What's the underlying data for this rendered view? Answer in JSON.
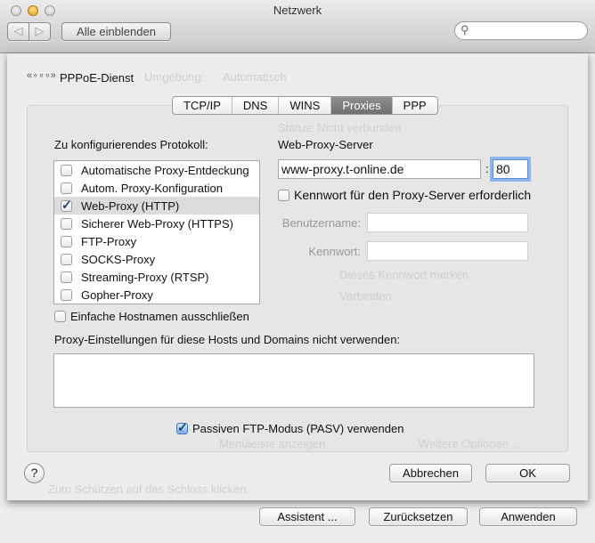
{
  "window": {
    "title": "Netzwerk",
    "show_all": "Alle einblenden",
    "search_placeholder": ""
  },
  "background": {
    "location_label": "Umgebung:",
    "location_value": "Automatisch",
    "status": "Status:  Nicht verbunden",
    "remember_password": "Dieses Kennwort merken",
    "connect": "Verbinden",
    "menubar": "Menüleiste anzeigen",
    "more_options": "Weitere Optionen ...",
    "lock_hint": "Zum Schützen auf das Schloss klicken."
  },
  "sheet": {
    "service_name": "PPPoE-Dienst",
    "tabs": [
      {
        "label": "TCP/IP"
      },
      {
        "label": "DNS"
      },
      {
        "label": "WINS"
      },
      {
        "label": "Proxies",
        "selected": true
      },
      {
        "label": "PPP"
      }
    ],
    "protocol_label": "Zu konfigurierendes Protokoll:",
    "protocols": [
      {
        "label": "Automatische Proxy-Entdeckung",
        "checked": false
      },
      {
        "label": "Autom. Proxy-Konfiguration",
        "checked": false
      },
      {
        "label": "Web-Proxy (HTTP)",
        "checked": true,
        "selected": true
      },
      {
        "label": "Sicherer Web-Proxy (HTTPS)",
        "checked": false
      },
      {
        "label": "FTP-Proxy",
        "checked": false
      },
      {
        "label": "SOCKS-Proxy",
        "checked": false
      },
      {
        "label": "Streaming-Proxy (RTSP)",
        "checked": false
      },
      {
        "label": "Gopher-Proxy",
        "checked": false
      }
    ],
    "server_label": "Web-Proxy-Server",
    "server_value": "www-proxy.t-online.de",
    "port_separator": ":",
    "port_value": "80",
    "password_required": "Kennwort für den Proxy-Server erforderlich",
    "username_label": "Benutzername:",
    "username_value": "",
    "password_label": "Kennwort:",
    "password_value": "",
    "exclude_simple": "Einfache Hostnamen ausschließen",
    "bypass_label": "Proxy-Einstellungen für diese Hosts und Domains nicht verwenden:",
    "bypass_value": "",
    "passive_ftp": "Passiven FTP-Modus (PASV) verwenden",
    "passive_ftp_checked": true,
    "help": "?",
    "cancel": "Abbrechen",
    "ok": "OK"
  },
  "footer": {
    "assistant": "Assistent ...",
    "revert": "Zurücksetzen",
    "apply": "Anwenden"
  }
}
